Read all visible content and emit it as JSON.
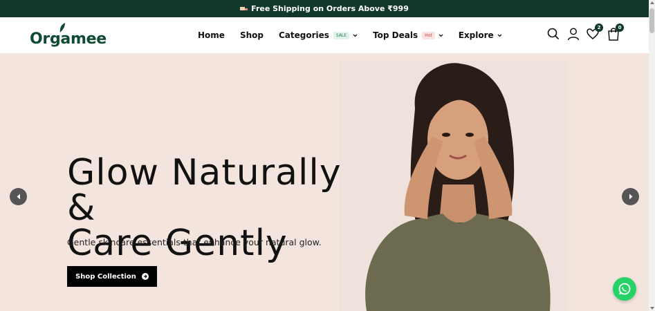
{
  "announcement": {
    "text": "Free Shipping on Orders Above ₹999",
    "icon": "truck-icon"
  },
  "brand": {
    "name": "Orgamee",
    "color": "#0f4a32"
  },
  "nav": {
    "items": [
      {
        "label": "Home"
      },
      {
        "label": "Shop"
      },
      {
        "label": "Categories",
        "badge": "SALE"
      },
      {
        "label": "Top Deals",
        "badge": "Hot"
      },
      {
        "label": "Explore"
      }
    ]
  },
  "header_icons": {
    "search": "search-icon",
    "account": "user-icon",
    "wishlist": {
      "icon": "heart-icon",
      "count": "2"
    },
    "cart": {
      "icon": "cart-icon",
      "count": "0"
    }
  },
  "hero": {
    "title_line1": "Glow Naturally &",
    "title_line2": "Care Gently",
    "subtitle": "Gentle skincare essentials that enhance your natural glow.",
    "cta_label": "Shop Collection",
    "background": "#f3e4dd"
  },
  "colors": {
    "topbar": "#12382b",
    "accent": "#12382b",
    "button": "#000000",
    "whatsapp": "#25d366"
  }
}
